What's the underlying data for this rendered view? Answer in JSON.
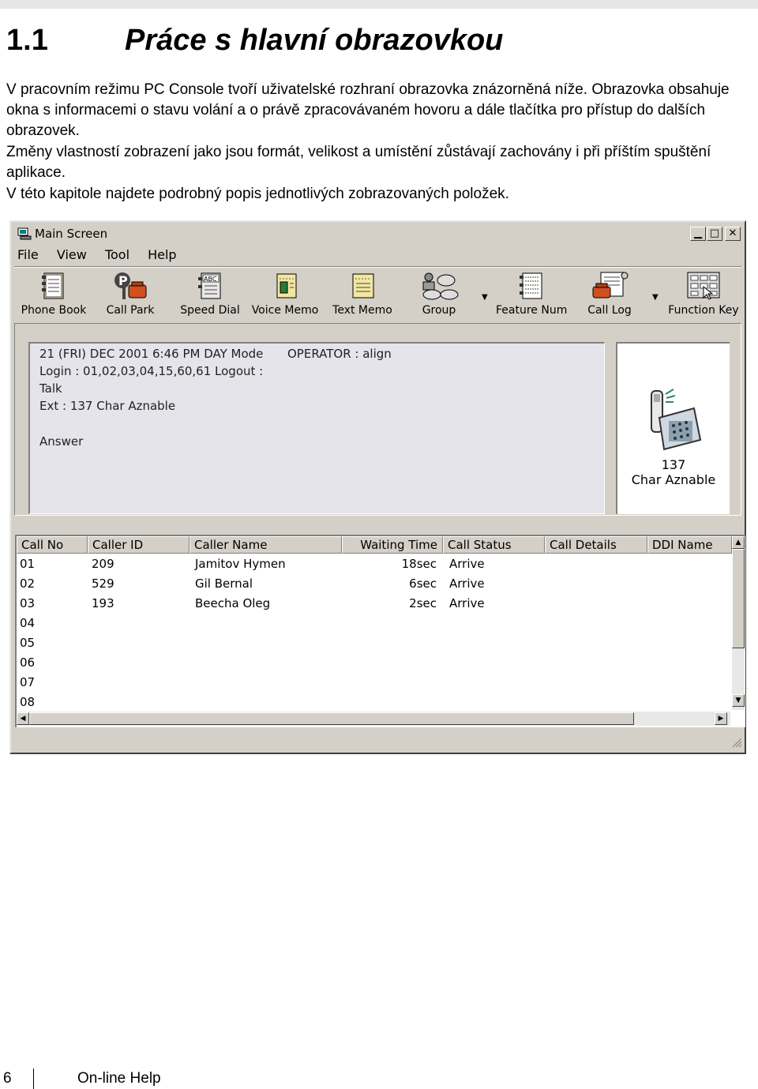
{
  "section": {
    "number": "1.1",
    "title": "Práce s hlavní obrazovkou"
  },
  "paragraphs": [
    "V pracovním režimu PC Console tvoří uživatelské rozhraní obrazovka znázorněná níže. Obrazovka obsahuje okna s informacemi o stavu volání a o právě zpracovávaném hovoru a dále tlačítka pro přístup do dalších obrazovek.",
    "Změny vlastností zobrazení jako jsou formát, velikost a umístění zůstávají zachovány i při příštím spuštění aplikace.",
    "V této kapitole najdete podrobný popis jednotlivých zobrazovaných položek."
  ],
  "window": {
    "title": "Main Screen",
    "controls": {
      "minimize": "▁",
      "maximize": "□",
      "close": "✕"
    },
    "menu": [
      "File",
      "View",
      "Tool",
      "Help"
    ],
    "toolbar": [
      {
        "label": "Phone Book",
        "icon": "phone-book-icon"
      },
      {
        "label": "Call Park",
        "icon": "call-park-icon"
      },
      {
        "label": "Speed Dial",
        "icon": "speed-dial-icon"
      },
      {
        "label": "Voice Memo",
        "icon": "voice-memo-icon"
      },
      {
        "label": "Text Memo",
        "icon": "text-memo-icon"
      },
      {
        "label": "Group",
        "icon": "group-icon"
      },
      {
        "label": "Feature Num",
        "icon": "feature-num-icon"
      },
      {
        "label": "Call Log",
        "icon": "call-log-icon"
      },
      {
        "label": "Function Key",
        "icon": "function-key-icon"
      }
    ],
    "dropdown_glyph": "▼",
    "status": {
      "line1": "21 (FRI) DEC 2001  6:46 PM DAY Mode",
      "operator": "OPERATOR : align",
      "line2": "Login : 01,02,03,04,15,60,61 Logout :",
      "line3": "Talk",
      "line4": "Ext : 137 Char Aznable",
      "line5": "Answer"
    },
    "operator_panel": {
      "ext": "137",
      "name": "Char Aznable"
    },
    "calls": {
      "columns": [
        "Call No",
        "Caller ID",
        "Caller Name",
        "Waiting Time",
        "Call Status",
        "Call Details",
        "DDI Name"
      ],
      "rows": [
        [
          "01",
          "209",
          "Jamitov Hymen",
          "18sec",
          "Arrive"
        ],
        [
          "02",
          "529",
          "Gil Bernal",
          "6sec",
          "Arrive"
        ],
        [
          "03",
          "193",
          "Beecha Oleg",
          "2sec",
          "Arrive"
        ],
        [
          "04",
          "",
          "",
          "",
          ""
        ],
        [
          "05",
          "",
          "",
          "",
          ""
        ],
        [
          "06",
          "",
          "",
          "",
          ""
        ],
        [
          "07",
          "",
          "",
          "",
          ""
        ],
        [
          "08",
          "",
          "",
          "",
          ""
        ]
      ]
    },
    "scroll_glyphs": {
      "up": "▲",
      "down": "▼",
      "left": "◀",
      "right": "▶"
    }
  },
  "footer": {
    "page": "6",
    "text": "On-line Help"
  }
}
